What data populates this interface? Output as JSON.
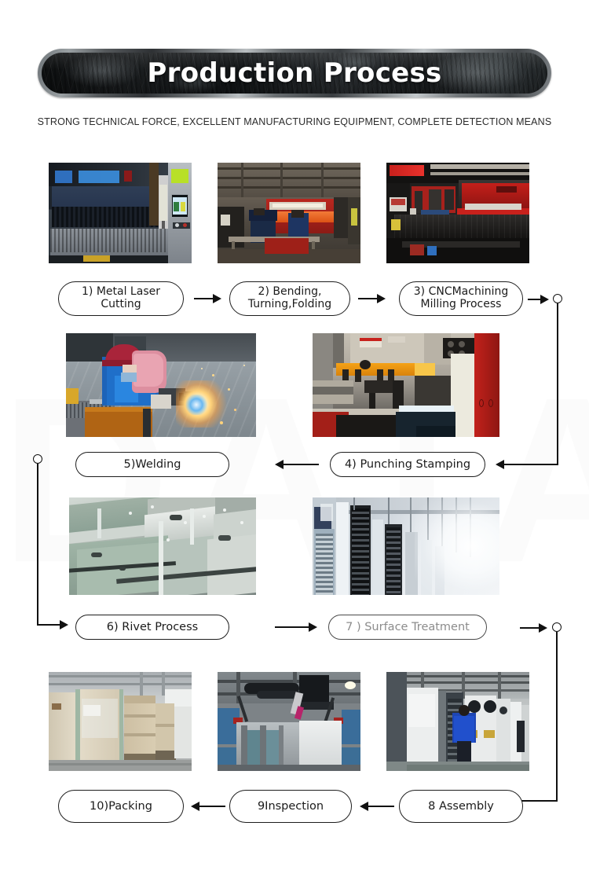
{
  "header": {
    "title": "Production Process",
    "subtitle": "STRONG TECHNICAL FORCE, EXCELLENT MANUFACTURING EQUIPMENT, COMPLETE DETECTION MEANS",
    "banner_bg_color": "#1b1e20",
    "banner_frame_color": "#8d9295",
    "title_color": "#ffffff",
    "subtitle_color": "#2b2b2b"
  },
  "watermark": {
    "text": "DATA",
    "color": "#fbfbfb"
  },
  "steps": [
    {
      "id": "step-1",
      "label": "1) Metal Laser\nCutting",
      "number": "1",
      "name": "Metal Laser Cutting",
      "photo": "metal-laser-cutting-machine"
    },
    {
      "id": "step-2",
      "label": "2) Bending,\nTurning,Folding",
      "number": "2",
      "name": "Bending, Turning, Folding",
      "photo": "press-brake-bending-workers"
    },
    {
      "id": "step-3",
      "label": "3) CNCMachining\nMilling Process",
      "number": "3",
      "name": "CNC Machining Milling Process",
      "photo": "cnc-turret-punch-yawei"
    },
    {
      "id": "step-4",
      "label": "4) Punching Stamping",
      "number": "4",
      "name": "Punching Stamping",
      "photo": "punching-stamping-press"
    },
    {
      "id": "step-5",
      "label": "5)Welding",
      "number": "5",
      "name": "Welding",
      "photo": "welder-with-sparks"
    },
    {
      "id": "step-6",
      "label": "6) Rivet Process",
      "number": "6",
      "name": "Rivet Process",
      "photo": "riveted-sheet-metal-frames"
    },
    {
      "id": "step-7",
      "label": "7 ) Surface Treatment",
      "number": "7",
      "name": "Surface Treatment",
      "photo": "powder-coating-spray-line"
    },
    {
      "id": "step-8",
      "label": "8 Assembly",
      "number": "8",
      "name": "Assembly",
      "photo": "cabinet-frame-assembly"
    },
    {
      "id": "step-9",
      "label": "9Inspection",
      "number": "9",
      "name": "Inspection",
      "photo": "worker-inspecting-cabinets"
    },
    {
      "id": "step-10",
      "label": "10)Packing",
      "number": "10",
      "name": "Packing",
      "photo": "packed-cartons-warehouse"
    }
  ],
  "flow": {
    "direction_row1": "left-to-right",
    "direction_row2": "right-to-left",
    "direction_row3": "left-to-right",
    "direction_row4": "right-to-left",
    "connector_color": "#111111"
  }
}
